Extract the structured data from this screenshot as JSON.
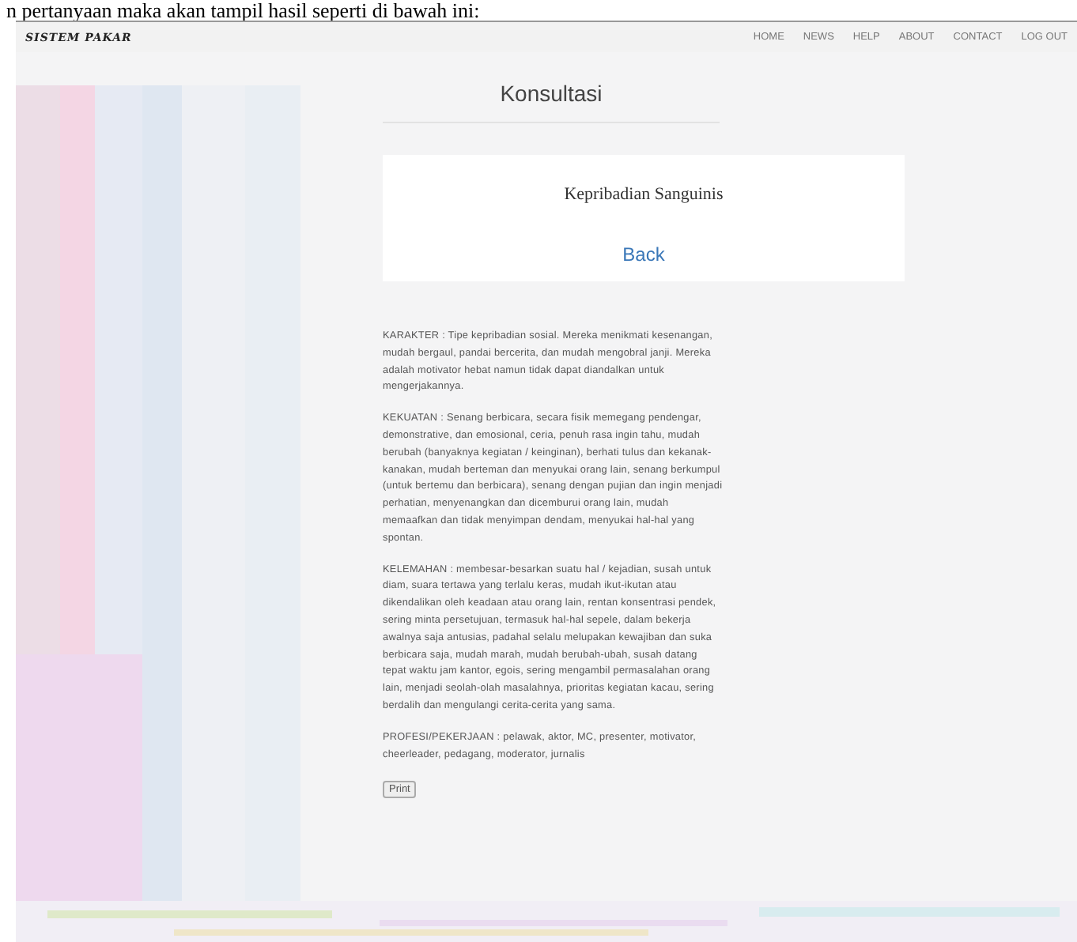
{
  "document_caption": "n pertanyaan maka akan tampil hasil seperti di bawah ini:",
  "navbar": {
    "brand": "SISTEM PAKAR",
    "links": [
      {
        "label": "HOME"
      },
      {
        "label": "NEWS"
      },
      {
        "label": "HELP"
      },
      {
        "label": "ABOUT"
      },
      {
        "label": "CONTACT"
      },
      {
        "label": "LOG OUT"
      }
    ]
  },
  "page_title": "Konsultasi",
  "result_card": {
    "title": "Kepribadian Sanguinis",
    "link": "Back"
  },
  "paragraphs": [
    "KARAKTER : Tipe kepribadian sosial. Mereka menikmati kesenangan, mudah bergaul, pandai bercerita, dan mudah mengobral janji. Mereka adalah motivator hebat namun tidak dapat diandalkan untuk mengerjakannya.",
    "KEKUATAN : Senang berbicara, secara fisik memegang pendengar, demonstrative, dan emosional, ceria, penuh rasa ingin tahu, mudah berubah (banyaknya kegiatan / keinginan), berhati tulus dan kekanak-kanakan, mudah berteman dan menyukai orang lain, senang berkumpul (untuk bertemu dan berbicara), senang dengan pujian dan ingin menjadi perhatian, menyenangkan dan dicemburui orang lain, mudah memaafkan dan tidak menyimpan dendam, menyukai hal-hal yang spontan.",
    "KELEMAHAN : membesar-besarkan suatu hal / kejadian, susah untuk diam, suara tertawa yang terlalu keras, mudah ikut-ikutan atau dikendalikan oleh keadaan atau orang lain, rentan konsentrasi pendek, sering minta persetujuan, termasuk hal-hal sepele, dalam bekerja awalnya saja antusias, padahal selalu melupakan kewajiban dan suka berbicara saja, mudah marah, mudah berubah-ubah, susah datang tepat waktu jam kantor, egois, sering mengambil permasalahan orang lain, menjadi seolah-olah masalahnya, prioritas kegiatan kacau, sering berdalih dan mengulangi cerita-cerita yang sama.",
    "PROFESI/PEKERJAAN : pelawak, aktor, MC, presenter, motivator, cheerleader, pedagang, moderator, jurnalis"
  ],
  "print_button": "Print"
}
